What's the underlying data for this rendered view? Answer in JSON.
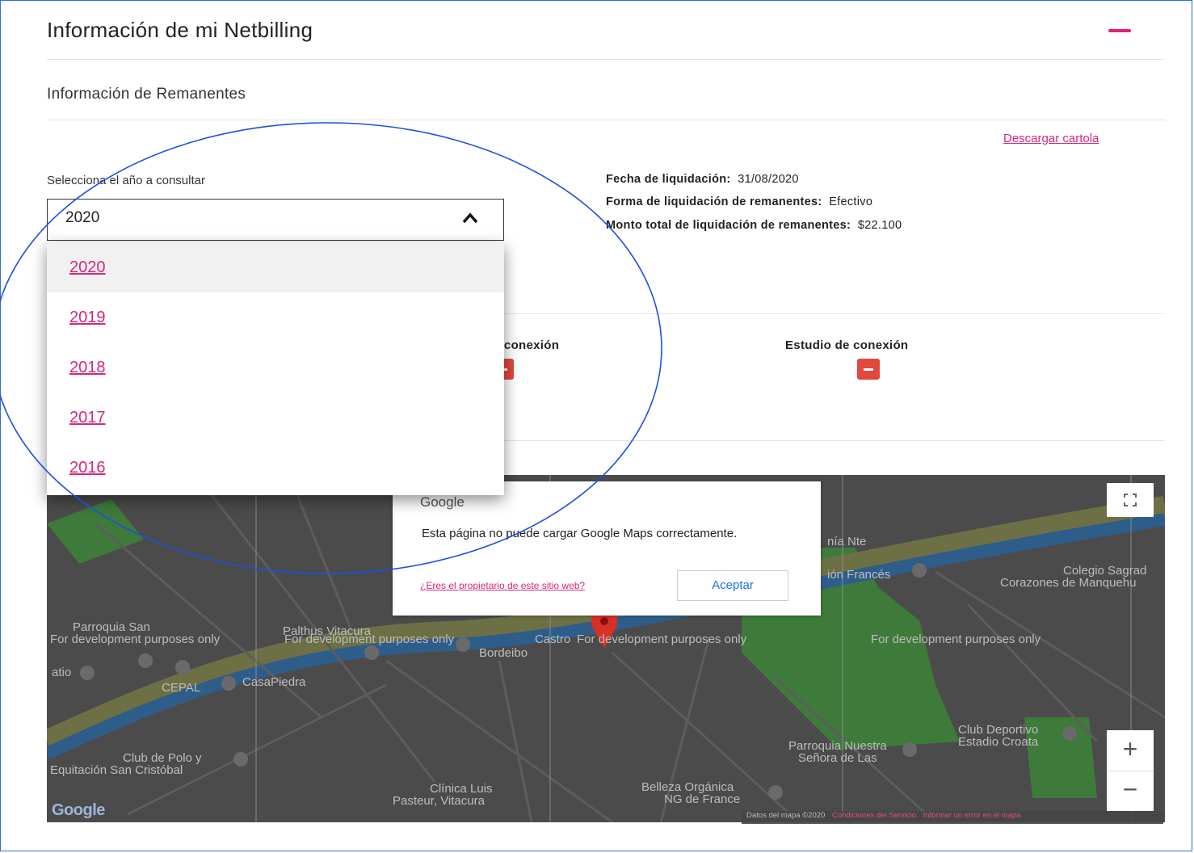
{
  "section": {
    "title": "Información de mi Netbilling",
    "subtitle": "Información de Remanentes",
    "download_link": "Descargar cartola",
    "year_label": "Selecciona el año a consultar",
    "selected_year": "2020",
    "year_options": [
      "2020",
      "2019",
      "2018",
      "2017",
      "2016"
    ]
  },
  "liquidation": {
    "date_label": "Fecha de liquidación:",
    "date_value": "31/08/2020",
    "form_label": "Forma de liquidación de remanentes:",
    "form_value": "Efectivo",
    "total_label": "Monto total de liquidación de remanentes:",
    "total_value": "$22.100"
  },
  "documents": {
    "doc1_label": "o conexión",
    "doc2_label": "Estudio de conexión"
  },
  "map": {
    "dialog_brand": "Google",
    "dialog_message": "Esta página no puede cargar Google Maps correctamente.",
    "dialog_question": "¿Eres el propietario de este sitio web?",
    "dialog_accept": "Aceptar",
    "dev_watermark": "For development purposes only",
    "labels": {
      "parroquia_san": "Parroquia San",
      "palthus": "Palthus Vitacura",
      "casapiedra": "CasaPiedra",
      "cepal": "CEPAL",
      "club_polo": "Club de Polo y",
      "equitacion": "Equitación San Cristóbal",
      "clinica_1": "Clínica Luis",
      "clinica_2": "Pasteur, Vitacura",
      "belleza_1": "Belleza Orgánica",
      "belleza_2": "NG de France",
      "parroquia_ns_1": "Parroquia Nuestra",
      "parroquia_ns_2": "Señora de Las",
      "club_dep_1": "Club Deportivo",
      "club_dep_2": "Estadio Croata",
      "colegio_1": "Colegio Sagrad",
      "colegio_2": "Corazones de Manquehu",
      "frances": "ión Francés",
      "castro": "Castro",
      "bordeibo": "Bordeibo",
      "atio": "atio",
      "nte": "nía Nte"
    },
    "footer_data": "Datos del mapa ©2020",
    "footer_terms": "Condiciones del Servicio",
    "footer_report": "Informar un error en el mapa",
    "zoom_in": "+",
    "zoom_out": "−",
    "google_logo": "Google"
  },
  "colors": {
    "accent": "#d4287c",
    "annotation": "#1f4fe0",
    "doc_icon": "#e2483d"
  }
}
